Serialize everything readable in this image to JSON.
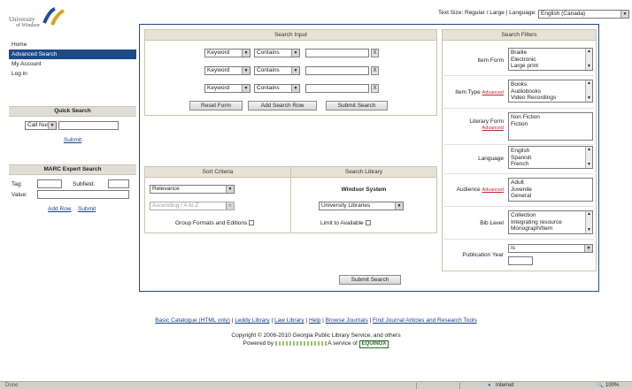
{
  "logo": {
    "line1": "University",
    "line2": "of Windsor"
  },
  "topbar": {
    "textsize_label": "Text Size:",
    "regular": "Regular",
    "sep": "/",
    "large": "Large",
    "language_label": "| Language:",
    "language_value": "English (Canada)"
  },
  "sidebar": {
    "nav": [
      "Home",
      "Advanced Search",
      "My Account",
      "Log in"
    ],
    "quick_search": {
      "title": "Quick Search",
      "select_value": "Call Num",
      "submit": "Submit"
    },
    "marc": {
      "title": "MARC Expert Search",
      "tag_label": "Tag:",
      "subfield_label": "Subfield:",
      "value_label": "Value:",
      "add_row": "Add Row",
      "submit": "Submit"
    }
  },
  "search_input": {
    "title": "Search Input",
    "rows": [
      {
        "field": "Keyword",
        "op": "Contains",
        "x": "X"
      },
      {
        "field": "Keyword",
        "op": "Contains",
        "x": "X"
      },
      {
        "field": "Keyword",
        "op": "Contains",
        "x": "X"
      }
    ],
    "reset": "Reset Form",
    "add_row": "Add Search Row",
    "submit": "Submit Search"
  },
  "sort": {
    "title": "Sort Criteria",
    "value": "Relevance",
    "order": "Ascending / A to Z",
    "group_label": "Group Formats and Editions"
  },
  "library": {
    "title": "Search Library",
    "system": "Windsor System",
    "value": "University Libraries",
    "limit_label": "Limit to Available"
  },
  "bottom_submit": "Submit Search",
  "filters": {
    "title": "Search Filters",
    "item_form": {
      "label": "Item Form",
      "options": [
        "Braille",
        "Electronic",
        "Large print"
      ]
    },
    "item_type": {
      "label": "Item Type",
      "adv": "Advanced",
      "options": [
        "Books",
        "Audiobooks",
        "Video Recordings"
      ]
    },
    "literary_form": {
      "label": "Literary Form",
      "adv": "Advanced",
      "options": [
        "Non Fiction",
        "Fiction"
      ]
    },
    "language": {
      "label": "Language",
      "options": [
        "English",
        "Spanish",
        "French"
      ]
    },
    "audience": {
      "label": "Audience",
      "adv": "Advanced",
      "options": [
        "Adult",
        "Juvenile",
        "General"
      ]
    },
    "bib_level": {
      "label": "Bib Level",
      "options": [
        "Collection",
        "Integrating resource",
        "Monograph/Item"
      ]
    },
    "pub_year": {
      "label": "Publication Year",
      "op": "Is"
    }
  },
  "footer": {
    "links": [
      "Basic Catalogue (HTML only)",
      "Leddy Library",
      "Law Library",
      "Help",
      "Browse Journals",
      "Find Journal Articles and Research Tools"
    ],
    "sep": "|",
    "copyright": "Copyright © 2006-2010 Georgia Public Library Service, and others",
    "powered_by": "Powered by",
    "service_of": "A service of",
    "equinox": "EQUINOX"
  },
  "statusbar": {
    "status": "Done",
    "zone": "Internet",
    "zoom": "100%"
  },
  "colors": {
    "nav_active": "#1d4a88",
    "header_bg": "#e6e2d6",
    "statusbar": "#d4d0c8",
    "logo_blue": "#1f4f9a",
    "logo_gold": "#d8a41a"
  }
}
